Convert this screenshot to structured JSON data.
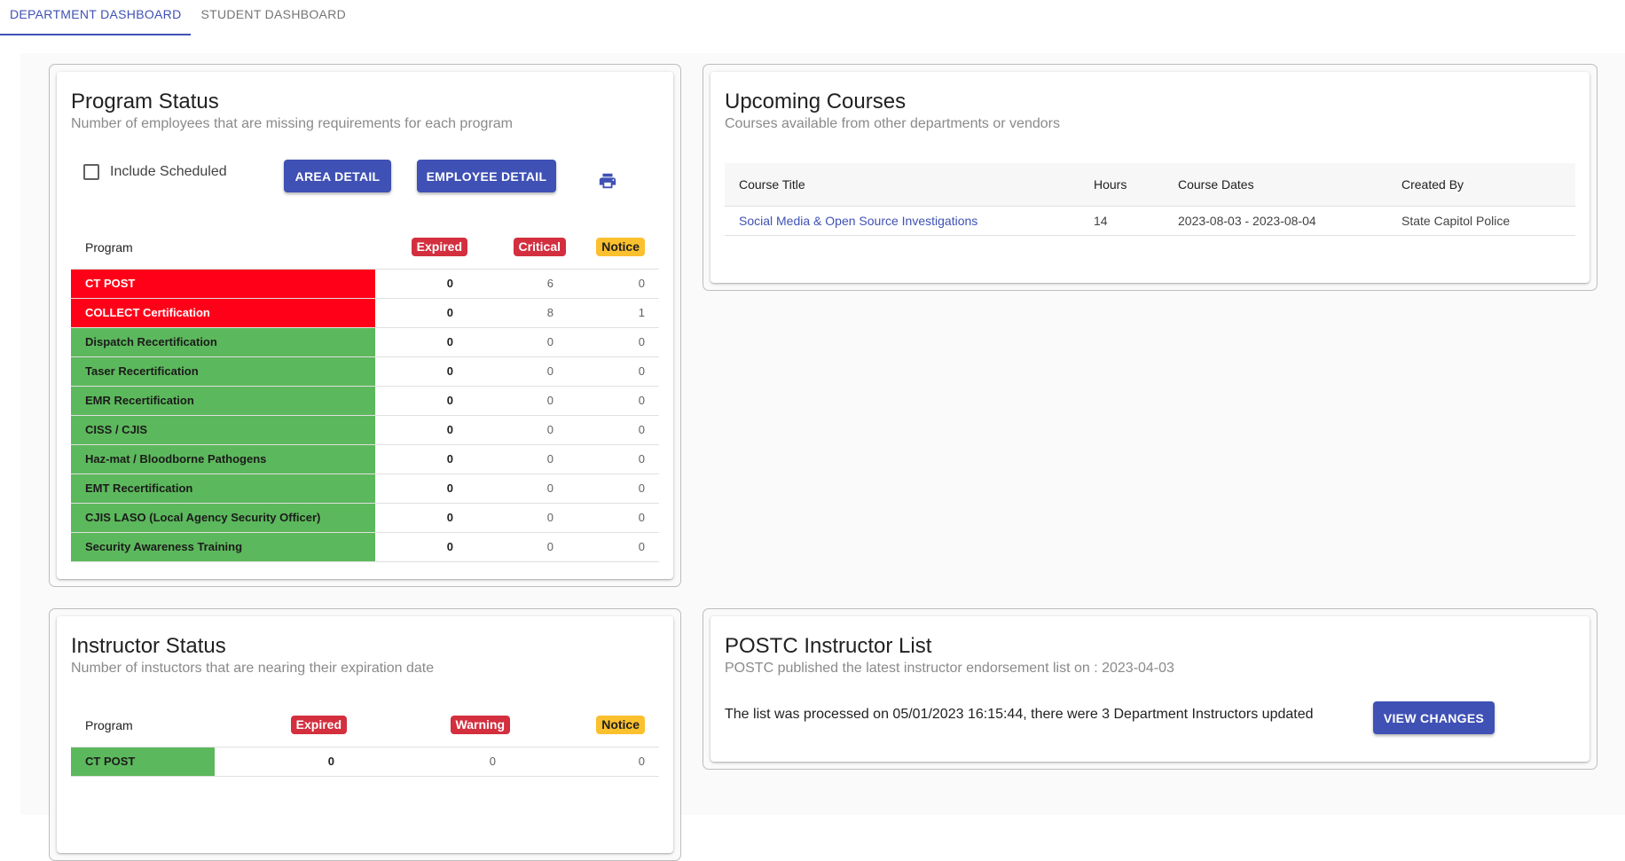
{
  "tabs": [
    {
      "label": "DEPARTMENT DASHBOARD"
    },
    {
      "label": "STUDENT DASHBOARD"
    }
  ],
  "program_status": {
    "title": "Program Status",
    "subtitle": "Number of employees that are missing requirements for each program",
    "include_scheduled_label": "Include Scheduled",
    "include_scheduled_checked": false,
    "area_detail_label": "AREA DETAIL",
    "employee_detail_label": "EMPLOYEE DETAIL",
    "print_icon": "print-icon",
    "columns": {
      "program": "Program",
      "expired": "Expired",
      "critical": "Critical",
      "notice": "Notice"
    },
    "rows": [
      {
        "program": "CT POST",
        "status": "red",
        "expired": "0",
        "critical": "6",
        "notice": "0"
      },
      {
        "program": "COLLECT Certification",
        "status": "red",
        "expired": "0",
        "critical": "8",
        "notice": "1"
      },
      {
        "program": "Dispatch Recertification",
        "status": "green",
        "expired": "0",
        "critical": "0",
        "notice": "0"
      },
      {
        "program": "Taser Recertification",
        "status": "green",
        "expired": "0",
        "critical": "0",
        "notice": "0"
      },
      {
        "program": "EMR Recertification",
        "status": "green",
        "expired": "0",
        "critical": "0",
        "notice": "0"
      },
      {
        "program": "CISS / CJIS",
        "status": "green",
        "expired": "0",
        "critical": "0",
        "notice": "0"
      },
      {
        "program": "Haz-mat / Bloodborne Pathogens",
        "status": "green",
        "expired": "0",
        "critical": "0",
        "notice": "0"
      },
      {
        "program": "EMT Recertification",
        "status": "green",
        "expired": "0",
        "critical": "0",
        "notice": "0"
      },
      {
        "program": "CJIS LASO (Local Agency Security Officer)",
        "status": "green",
        "expired": "0",
        "critical": "0",
        "notice": "0"
      },
      {
        "program": "Security Awareness Training",
        "status": "green",
        "expired": "0",
        "critical": "0",
        "notice": "0"
      }
    ]
  },
  "upcoming_courses": {
    "title": "Upcoming Courses",
    "subtitle": "Courses available from other departments or vendors",
    "columns": {
      "title": "Course Title",
      "hours": "Hours",
      "dates": "Course Dates",
      "created_by": "Created By"
    },
    "rows": [
      {
        "title": "Social Media & Open Source Investigations",
        "hours": "14",
        "dates": "2023-08-03 - 2023-08-04",
        "created_by": "State Capitol Police"
      }
    ]
  },
  "instructor_status": {
    "title": "Instructor Status",
    "subtitle": "Number of instuctors that are nearing their expiration date",
    "columns": {
      "program": "Program",
      "expired": "Expired",
      "warning": "Warning",
      "notice": "Notice"
    },
    "rows": [
      {
        "program": "CT POST",
        "status": "green",
        "expired": "0",
        "warning": "0",
        "notice": "0"
      }
    ]
  },
  "postc_list": {
    "title": "POSTC Instructor List",
    "subtitle": "POSTC published the latest instructor endorsement list on : 2023-04-03",
    "message": "The list was processed on 05/01/2023 16:15:44, there were 3 Department Instructors updated",
    "view_changes_label": "VIEW CHANGES"
  },
  "colors": {
    "primary": "#3f51b5",
    "status_red": "#ff0018",
    "status_green": "#5cb85c",
    "badge_red": "#d32f3f",
    "badge_amber": "#fbc02d"
  }
}
